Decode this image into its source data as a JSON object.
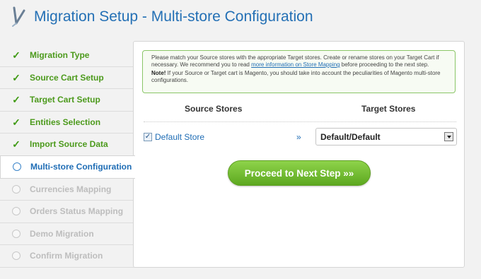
{
  "header": {
    "title": "Migration Setup - Multi-store Configuration"
  },
  "sidebar": {
    "steps": [
      {
        "label": "Migration Type",
        "state": "done"
      },
      {
        "label": "Source Cart Setup",
        "state": "done"
      },
      {
        "label": "Target Cart Setup",
        "state": "done"
      },
      {
        "label": "Entities Selection",
        "state": "done"
      },
      {
        "label": "Import Source Data",
        "state": "done"
      },
      {
        "label": "Multi-store Configuration",
        "state": "active"
      },
      {
        "label": "Currencies Mapping",
        "state": "pending"
      },
      {
        "label": "Orders Status Mapping",
        "state": "pending"
      },
      {
        "label": "Demo Migration",
        "state": "pending"
      },
      {
        "label": "Confirm Migration",
        "state": "pending"
      }
    ]
  },
  "notice": {
    "text_before_link": "Please match your Source stores with the appropriate Target stores. Create or rename stores on your Target Cart if necessary. We recommend you to read ",
    "link_text": "more information on Store Mapping",
    "text_after_link": " before proceeding to the next step.",
    "note_label": "Note!",
    "note_text": " If your Source or Target cart is Magento, you should take into account the peculiarities of Magento multi-store configurations."
  },
  "mapping": {
    "source_header": "Source Stores",
    "target_header": "Target Stores",
    "rows": [
      {
        "source_label": "Default Store",
        "checked": true,
        "arrow": "»",
        "target_value": "Default/Default"
      }
    ]
  },
  "actions": {
    "proceed_label": "Proceed to Next Step »»"
  },
  "colors": {
    "title_blue": "#2470b5",
    "done_green": "#4c9a1c",
    "button_green": "#6fbf2d"
  }
}
